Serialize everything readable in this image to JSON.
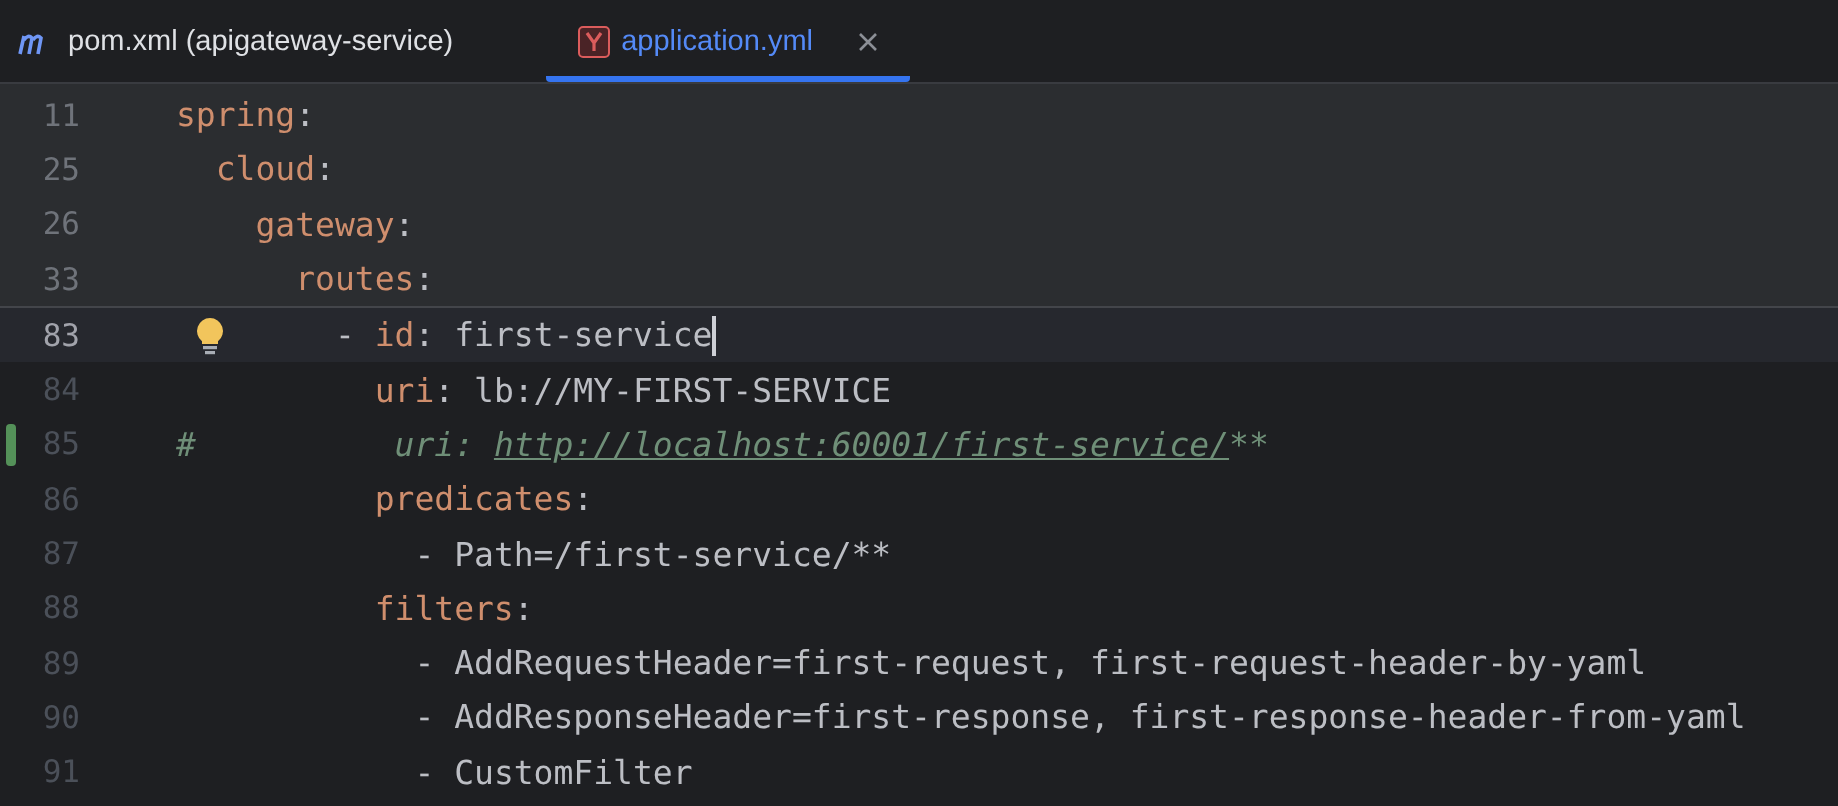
{
  "tabs": [
    {
      "label": "pom.xml (apigateway-service)",
      "kind": "maven",
      "selected": false
    },
    {
      "label": "application.yml",
      "kind": "yaml",
      "selected": true
    }
  ],
  "editor": {
    "sticky_lines": [
      {
        "number": "11",
        "segments": [
          {
            "text": "spring",
            "kind": "key"
          },
          {
            "text": ":",
            "kind": "plain"
          }
        ]
      },
      {
        "number": "25",
        "segments": [
          {
            "text": "  cloud",
            "kind": "key"
          },
          {
            "text": ":",
            "kind": "plain"
          }
        ]
      },
      {
        "number": "26",
        "segments": [
          {
            "text": "    gateway",
            "kind": "key"
          },
          {
            "text": ":",
            "kind": "plain"
          }
        ]
      },
      {
        "number": "33",
        "segments": [
          {
            "text": "      routes",
            "kind": "key"
          },
          {
            "text": ":",
            "kind": "plain"
          }
        ]
      }
    ],
    "lines": [
      {
        "number": "83",
        "current": true,
        "bulb": true,
        "changed": false,
        "caret": true,
        "segments": [
          {
            "text": "        - ",
            "kind": "plain"
          },
          {
            "text": "id",
            "kind": "key"
          },
          {
            "text": ": first-service",
            "kind": "plain"
          }
        ]
      },
      {
        "number": "84",
        "current": false,
        "bulb": false,
        "changed": false,
        "caret": false,
        "segments": [
          {
            "text": "          uri",
            "kind": "key"
          },
          {
            "text": ": lb://MY-FIRST-SERVICE",
            "kind": "plain"
          }
        ]
      },
      {
        "number": "85",
        "current": false,
        "bulb": false,
        "changed": true,
        "caret": false,
        "segments": [
          {
            "text": "#          uri: ",
            "kind": "comment"
          },
          {
            "text": "http://localhost:60001/first-service/",
            "kind": "link"
          },
          {
            "text": "**",
            "kind": "comment"
          }
        ]
      },
      {
        "number": "86",
        "current": false,
        "bulb": false,
        "changed": false,
        "caret": false,
        "segments": [
          {
            "text": "          predicates",
            "kind": "key"
          },
          {
            "text": ":",
            "kind": "plain"
          }
        ]
      },
      {
        "number": "87",
        "current": false,
        "bulb": false,
        "changed": false,
        "caret": false,
        "segments": [
          {
            "text": "            - Path=/first-service/**",
            "kind": "plain"
          }
        ]
      },
      {
        "number": "88",
        "current": false,
        "bulb": false,
        "changed": false,
        "caret": false,
        "segments": [
          {
            "text": "          filters",
            "kind": "key"
          },
          {
            "text": ":",
            "kind": "plain"
          }
        ]
      },
      {
        "number": "89",
        "current": false,
        "bulb": false,
        "changed": false,
        "caret": false,
        "segments": [
          {
            "text": "            - AddRequestHeader=first-request, first-request-header-by-yaml",
            "kind": "plain"
          }
        ]
      },
      {
        "number": "90",
        "current": false,
        "bulb": false,
        "changed": false,
        "caret": false,
        "segments": [
          {
            "text": "            - AddResponseHeader=first-response, first-response-header-from-yaml",
            "kind": "plain"
          }
        ]
      },
      {
        "number": "91",
        "current": false,
        "bulb": false,
        "changed": false,
        "caret": false,
        "segments": [
          {
            "text": "            - CustomFilter",
            "kind": "plain"
          }
        ]
      }
    ]
  }
}
